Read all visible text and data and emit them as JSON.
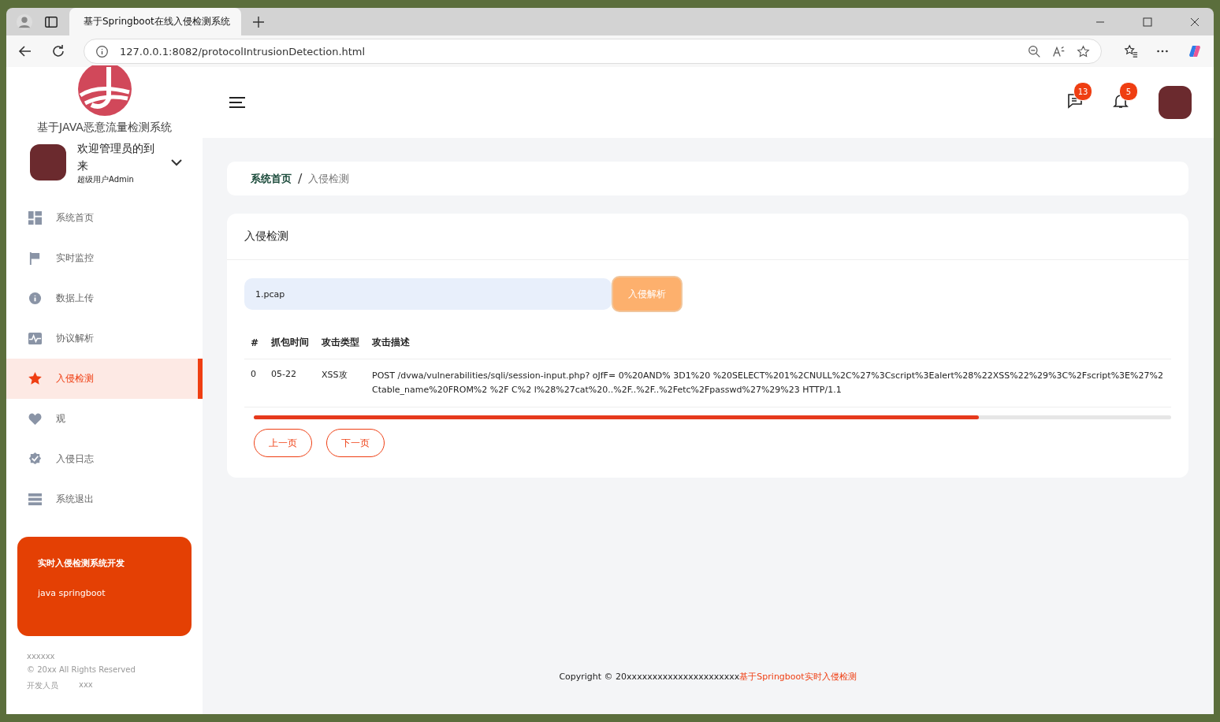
{
  "browser": {
    "tab_title": "基于Springboot在线入侵检测系统",
    "url": "127.0.0.1:8082/protocolIntrusionDetection.html"
  },
  "sidebar": {
    "logo_title": "基于JAVA恶意流量检测系统",
    "welcome": "欢迎管理员的到来",
    "role": "超级用户Admin",
    "items": [
      {
        "label": "系统首页",
        "selected": false
      },
      {
        "label": "实时监控",
        "selected": false
      },
      {
        "label": "数据上传",
        "selected": false
      },
      {
        "label": "协议解析",
        "selected": false
      },
      {
        "label": "入侵检测",
        "selected": true
      },
      {
        "label": "观",
        "selected": false
      },
      {
        "label": "入侵日志",
        "selected": false
      },
      {
        "label": "系统退出",
        "selected": false
      }
    ],
    "promo": {
      "title": "实时入侵检测系统开发",
      "text": "java springboot"
    },
    "footer": {
      "name": "xxxxxx",
      "rights": "© 20xx All Rights Reserved",
      "dev_label": "开发人员",
      "dev_value": "xxx"
    }
  },
  "header": {
    "messages_badge": "13",
    "notifications_badge": "5"
  },
  "breadcrumb": {
    "home": "系统首页",
    "separator": "/",
    "current": "入侵检测"
  },
  "card": {
    "title": "入侵检测",
    "file_value": "1.pcap",
    "analyze_button": "入侵解析",
    "table": {
      "columns": [
        "#",
        "抓包时间",
        "攻击类型",
        "攻击描述"
      ],
      "rows": [
        {
          "index": "0",
          "time": "05-22",
          "type": "XSS攻",
          "description": "POST /dvwa/vulnerabilities/sqli/session-input.php? oJfF= 0%20AND% 3D1%20 %20SELECT%201%2CNULL%2C%27%3Cscript%3Ealert%28%22XSS%22%29%3C%2Fscript%3E%27%2Ctable_name%20FROM%2 %2F C%2 l%28%27cat%20..%2F..%2F..%2Fetc%2Fpasswd%27%29%23 HTTP/1.1"
        }
      ]
    },
    "progress": {
      "level": 0.79
    },
    "prev_button": "上一页",
    "next_button": "下一页"
  },
  "footer": {
    "copyright": "Copyright © 20xxxxxxxxxxxxxxxxxxxxxx",
    "link": "基于Springboot实时入侵检测"
  }
}
